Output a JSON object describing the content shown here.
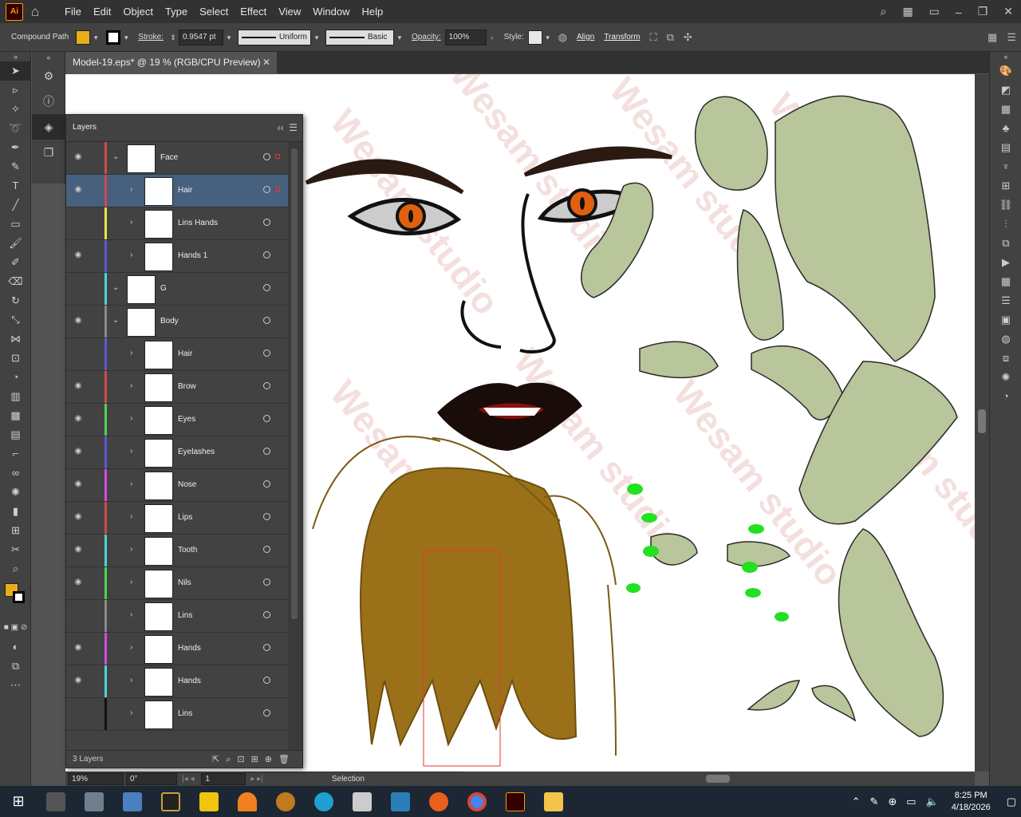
{
  "app": {
    "logo": "Ai"
  },
  "menu": [
    "File",
    "Edit",
    "Object",
    "Type",
    "Select",
    "Effect",
    "View",
    "Window",
    "Help"
  ],
  "control": {
    "selection_type": "Compound Path",
    "stroke_label": "Stroke:",
    "stroke_value": "0.9547 pt",
    "profile": "Uniform",
    "brush": "Basic",
    "opacity_label": "Opacity:",
    "opacity_value": "100%",
    "style_label": "Style:",
    "align": "Align",
    "transform": "Transform",
    "fill_color": "#e8ad1a"
  },
  "document": {
    "tab_title": "Model-19.eps* @ 19 % (RGB/CPU Preview)"
  },
  "layers_panel": {
    "title": "Layers",
    "footer_count": "3 Layers",
    "rows": [
      {
        "name": "Face",
        "color": "#d04a4a",
        "visible": true,
        "level": 0,
        "selected": false
      },
      {
        "name": "Hair",
        "color": "#d04a4a",
        "visible": true,
        "level": 1,
        "selected": true
      },
      {
        "name": "Lins Hands",
        "color": "#e6e64a",
        "visible": false,
        "level": 1,
        "selected": false
      },
      {
        "name": "Hands 1",
        "color": "#5a5ad6",
        "visible": true,
        "level": 1,
        "selected": false
      },
      {
        "name": "G",
        "color": "#4ad6d6",
        "visible": false,
        "level": 0,
        "selected": false
      },
      {
        "name": "Body",
        "color": "#8a8a8a",
        "visible": true,
        "level": 0,
        "selected": false
      },
      {
        "name": "Hair",
        "color": "#5a5ad6",
        "visible": false,
        "level": 1,
        "selected": false
      },
      {
        "name": "Brow",
        "color": "#d04a4a",
        "visible": true,
        "level": 1,
        "selected": false
      },
      {
        "name": "Eyes",
        "color": "#4ad64a",
        "visible": true,
        "level": 1,
        "selected": false
      },
      {
        "name": "Eyelashes",
        "color": "#5a5ad6",
        "visible": true,
        "level": 1,
        "selected": false
      },
      {
        "name": "Nose",
        "color": "#d64ad6",
        "visible": true,
        "level": 1,
        "selected": false
      },
      {
        "name": "Lips",
        "color": "#d04a4a",
        "visible": true,
        "level": 1,
        "selected": false
      },
      {
        "name": "Tooth",
        "color": "#4ad6d6",
        "visible": true,
        "level": 1,
        "selected": false
      },
      {
        "name": "Nils",
        "color": "#4ad64a",
        "visible": true,
        "level": 1,
        "selected": false
      },
      {
        "name": "Lins",
        "color": "#8a8a8a",
        "visible": false,
        "level": 1,
        "selected": false
      },
      {
        "name": "Hands",
        "color": "#d64ad6",
        "visible": true,
        "level": 1,
        "selected": false
      },
      {
        "name": "Hands",
        "color": "#4ad6d6",
        "visible": true,
        "level": 1,
        "selected": false
      },
      {
        "name": "Lins",
        "color": "#111111",
        "visible": false,
        "level": 1,
        "selected": false
      }
    ]
  },
  "statusbar": {
    "zoom": "19%",
    "rotation": "0°",
    "artboard": "1",
    "tool": "Selection"
  },
  "taskbar": {
    "time": "8:25 PM",
    "date": "4/18/2026"
  },
  "watermark": "Wesam studio"
}
